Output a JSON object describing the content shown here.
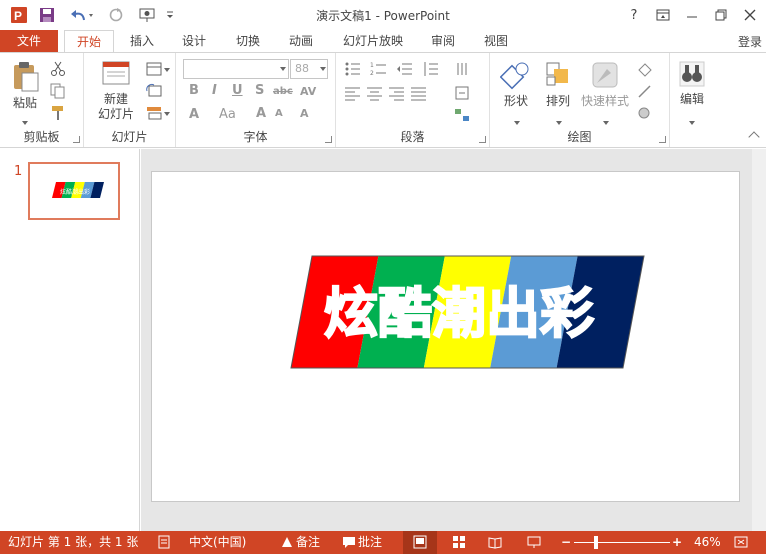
{
  "window": {
    "title": "演示文稿1 - PowerPoint"
  },
  "qat": {
    "app_icon": "powerpoint-icon",
    "save_icon": "save-icon",
    "undo_icon": "undo-icon",
    "redo_icon": "redo-icon",
    "present_icon": "present-from-start-icon"
  },
  "window_buttons": {
    "help": "?"
  },
  "tabs": [
    {
      "label": "文件"
    },
    {
      "label": "开始"
    },
    {
      "label": "插入"
    },
    {
      "label": "设计"
    },
    {
      "label": "切换"
    },
    {
      "label": "动画"
    },
    {
      "label": "幻灯片放映"
    },
    {
      "label": "审阅"
    },
    {
      "label": "视图"
    }
  ],
  "login": "登录",
  "ribbon": {
    "clipboard": {
      "paste": "粘贴",
      "group": "剪贴板"
    },
    "slides": {
      "new_slide_1": "新建",
      "new_slide_2": "幻灯片",
      "group": "幻灯片"
    },
    "font": {
      "size": "88",
      "group": "字体"
    },
    "paragraph": {
      "group": "段落"
    },
    "drawing": {
      "shape": "形状",
      "arrange": "排列",
      "quick_styles": "快速样式",
      "group": "绘图"
    },
    "editing": {
      "edit": "编辑"
    }
  },
  "thumbnail": {
    "number": "1",
    "mini_text": "炫酷潮出彩"
  },
  "slide": {
    "text": "炫酷潮出彩",
    "stripe_colors": [
      "#ff0000",
      "#00b050",
      "#ffff00",
      "#5b9bd5",
      "#002060"
    ]
  },
  "status": {
    "slide_info": "幻灯片 第 1 张，共 1 张",
    "language": "中文(中国)",
    "notes": "备注",
    "comments": "批注",
    "zoom": "46%"
  }
}
